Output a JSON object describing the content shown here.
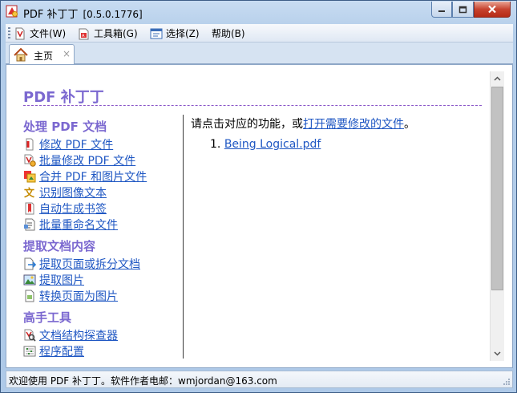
{
  "window": {
    "title": "PDF 补丁丁",
    "version": "[0.5.0.1776]"
  },
  "menu": {
    "items": [
      {
        "label": "文件(W)",
        "icon": "file-menu-icon"
      },
      {
        "label": "工具箱(G)",
        "icon": "toolbox-menu-icon"
      },
      {
        "label": "选择(Z)",
        "icon": "select-menu-icon"
      },
      {
        "label": "帮助(B)",
        "icon": ""
      }
    ]
  },
  "tabs": [
    {
      "label": "主页",
      "close": "×"
    }
  ],
  "home": {
    "app_title": "PDF 补丁丁",
    "sections": [
      {
        "title": "处理 PDF 文档",
        "links": [
          {
            "label": "修改 PDF 文件",
            "icon": "edit-pdf-icon"
          },
          {
            "label": "批量修改 PDF 文件",
            "icon": "batch-pdf-icon"
          },
          {
            "label": "合并 PDF 和图片文件",
            "icon": "merge-icon"
          },
          {
            "label": "识别图像文本",
            "icon": "ocr-icon"
          },
          {
            "label": "自动生成书签",
            "icon": "bookmark-icon"
          },
          {
            "label": "批量重命名文件",
            "icon": "rename-icon"
          }
        ]
      },
      {
        "title": "提取文档内容",
        "links": [
          {
            "label": "提取页面或拆分文档",
            "icon": "extract-pages-icon"
          },
          {
            "label": "提取图片",
            "icon": "extract-images-icon"
          },
          {
            "label": "转换页面为图片",
            "icon": "render-pages-icon"
          }
        ]
      },
      {
        "title": "高手工具",
        "links": [
          {
            "label": "文档结构探查器",
            "icon": "inspector-icon"
          },
          {
            "label": "程序配置",
            "icon": "settings-icon"
          }
        ]
      }
    ],
    "prompt_prefix": "请点击对应的功能，或",
    "prompt_link": "打开需要修改的文件",
    "prompt_suffix": "。",
    "recent_files": [
      {
        "index": "1.",
        "name": "Being Logical.pdf"
      }
    ]
  },
  "status": {
    "text": "欢迎使用 PDF 补丁丁。软件作者电邮：wmjordan@163.com"
  },
  "colors": {
    "accent_title": "#7b68d0",
    "link": "#1f57c3",
    "close_button": "#c7432f"
  }
}
